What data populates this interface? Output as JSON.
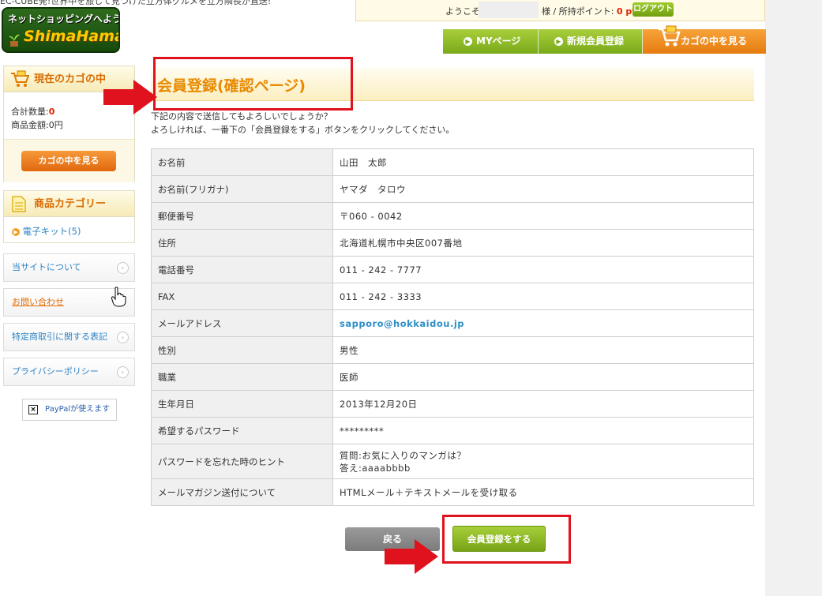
{
  "header": {
    "topline": "EC-CUBE発!世界中を旅して見つけた立方体グルメを立方隣長が直送!",
    "logo_line1": "ネットショッピングへようこそ",
    "logo_line2": "ShimaHamada",
    "welcome_prefix": "ようこそ",
    "welcome_suffix": "様 / 所持ポイント: ",
    "points": "0 pt",
    "logout_label": "ログアウト"
  },
  "nav": {
    "mypage": "MYページ",
    "register": "新規会員登録",
    "cart": "カゴの中を見る"
  },
  "sidebar": {
    "cart_title": "現在のカゴの中",
    "qty_label": "合計数量:",
    "qty_value": "0",
    "amount_label": "商品金額:",
    "amount_value": "0円",
    "cart_button": "カゴの中を見る",
    "category_title": "商品カテゴリー",
    "category_item": "電子キット(5)",
    "links": [
      "当サイトについて",
      "お問い合わせ",
      "特定商取引に関する表記",
      "プライバシーポリシー"
    ],
    "paypal_label": "PayPalが使えます"
  },
  "main": {
    "title": "会員登録(確認ページ)",
    "intro1": "下記の内容で送信してもよろしいでしょうか？",
    "intro2": "よろしければ、一番下の「会員登録をする」ボタンをクリックしてください。",
    "rows": [
      {
        "label": "お名前",
        "value": "山田　太郎"
      },
      {
        "label": "お名前(フリガナ)",
        "value": "ヤマダ　タロウ"
      },
      {
        "label": "郵便番号",
        "value": "〒060 - 0042"
      },
      {
        "label": "住所",
        "value": "北海道札幌市中央区007番地"
      },
      {
        "label": "電話番号",
        "value": "011 - 242 - 7777"
      },
      {
        "label": "FAX",
        "value": "011 - 242 - 3333"
      },
      {
        "label": "メールアドレス",
        "value": "sapporo@hokkaidou.jp"
      },
      {
        "label": "性別",
        "value": "男性"
      },
      {
        "label": "職業",
        "value": "医師"
      },
      {
        "label": "生年月日",
        "value": "2013年12月20日"
      },
      {
        "label": "希望するパスワード",
        "value": "*********"
      },
      {
        "label": "パスワードを忘れた時のヒント",
        "value": "質問:お気に入りのマンガは？",
        "value2": "答え:aaaabbbb"
      },
      {
        "label": "メールマガジン送付について",
        "value": "HTMLメール＋テキストメールを受け取る"
      }
    ],
    "back_label": "戻る",
    "submit_label": "会員登録をする"
  },
  "colors": {
    "accent_orange": "#e88a00",
    "nav_green": "#79a91a",
    "annotation_red": "#e0121d"
  }
}
